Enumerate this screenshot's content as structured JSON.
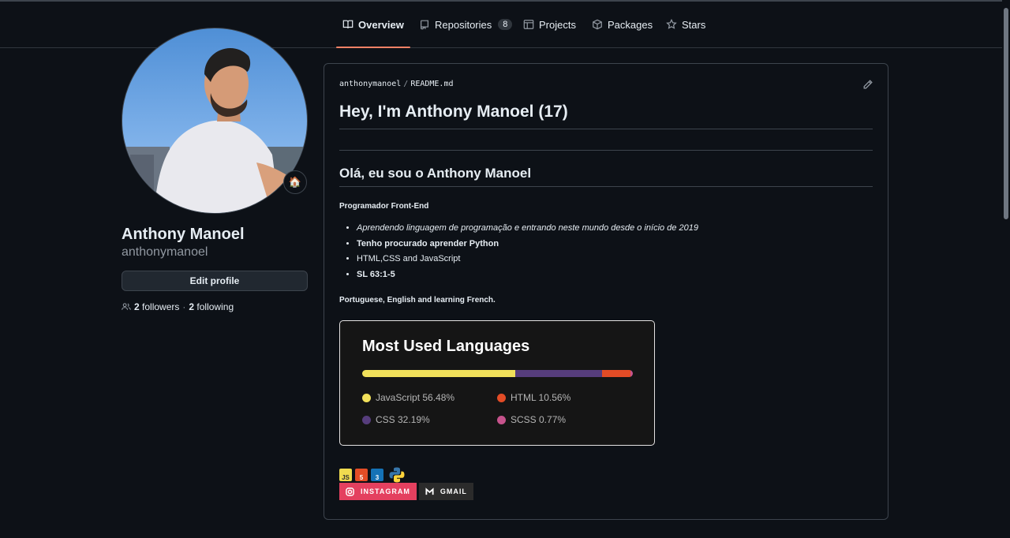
{
  "tabs": [
    {
      "label": "Overview",
      "icon": "book-icon",
      "active": true
    },
    {
      "label": "Repositories",
      "icon": "repo-icon",
      "count": "8"
    },
    {
      "label": "Projects",
      "icon": "table-icon"
    },
    {
      "label": "Packages",
      "icon": "package-icon"
    },
    {
      "label": "Stars",
      "icon": "star-icon"
    }
  ],
  "profile": {
    "name": "Anthony Manoel",
    "login": "anthonymanoel",
    "status_emoji": "🏠",
    "edit_label": "Edit profile",
    "followers_count": "2",
    "followers_label": "followers",
    "separator": "·",
    "following_count": "2",
    "following_label": "following"
  },
  "readme": {
    "owner": "anthonymanoel",
    "path_sep": "/",
    "file": "README.md",
    "h1": "Hey, I'm Anthony Manoel (17)",
    "h2": "Olá, eu sou o Anthony Manoel",
    "subtitle": "Programador Front-End",
    "bullets": [
      "Aprendendo linguagem de programação e entrando neste mundo desde o início de 2019",
      "Tenho procurado aprender Python",
      "HTML,CSS and JavaScript",
      "SL 63:1-5"
    ],
    "languages_line": "Portuguese, English and learning French.",
    "stats_card": {
      "title": "Most Used Languages",
      "languages": [
        {
          "label": "JavaScript 56.48%",
          "percent": 56.48,
          "color": "#f1e05a"
        },
        {
          "label": "CSS 32.19%",
          "percent": 32.19,
          "color": "#563d7c"
        },
        {
          "label": "HTML 10.56%",
          "percent": 10.56,
          "color": "#e34c26"
        },
        {
          "label": "SCSS 0.77%",
          "percent": 0.77,
          "color": "#c6538c"
        }
      ]
    },
    "tech_icons": {
      "js": "JS",
      "html": "5",
      "css": "3"
    },
    "social": {
      "instagram": "INSTAGRAM",
      "gmail": "GMAIL"
    }
  },
  "colors": {
    "background": "#0d1117",
    "accent_underline": "#f78166",
    "instagram": "#e4405f",
    "gmail": "#2b2b2b"
  }
}
